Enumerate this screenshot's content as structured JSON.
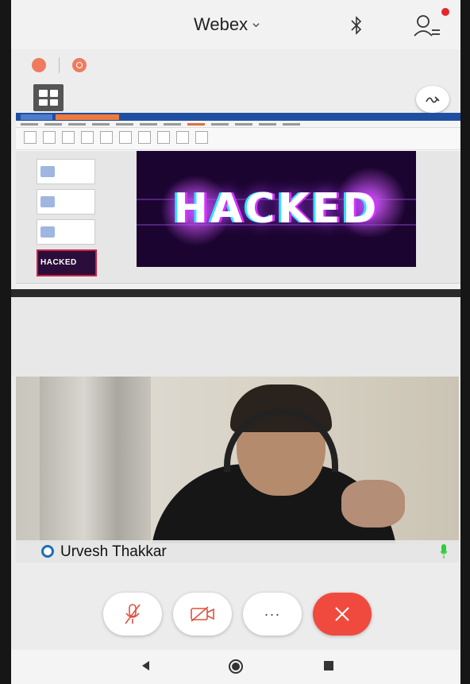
{
  "header": {
    "app_title": "Webex"
  },
  "slide": {
    "headline": "HACKED",
    "thumb_label": "HACKED"
  },
  "participant": {
    "name": "Urvesh Thakkar"
  },
  "controls": {
    "more_label": "···"
  },
  "colors": {
    "end_call": "#f04a3e",
    "notification": "#e5252a",
    "badge": "#ef7b5f",
    "mic_active": "#2ecc40"
  },
  "icons": [
    "chevron-down-icon",
    "bluetooth-icon",
    "user-settings-icon",
    "grid-layout-icon",
    "annotate-pen-icon",
    "mute-mic-icon",
    "video-off-icon",
    "more-icon",
    "end-call-icon",
    "nav-back-icon",
    "nav-home-icon",
    "nav-recents-icon"
  ]
}
